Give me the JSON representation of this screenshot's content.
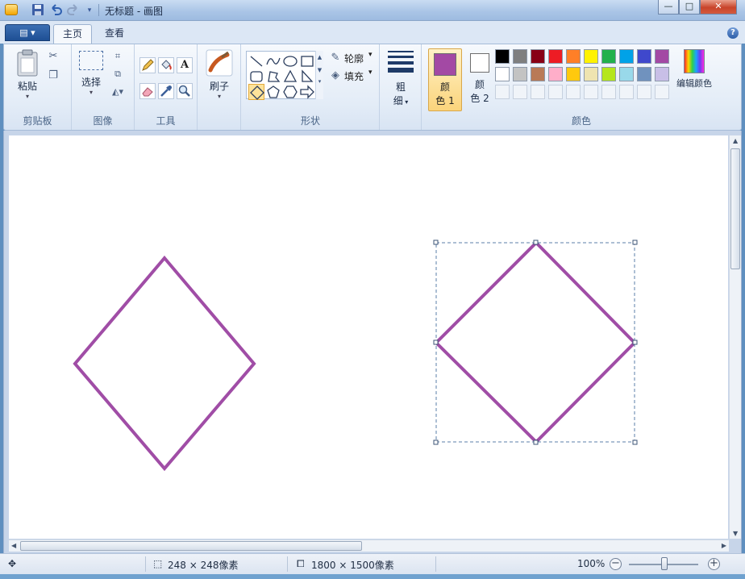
{
  "window": {
    "title": "无标题 - 画图",
    "buttons": {
      "minimize": "—",
      "maximize": "□",
      "close": "✕"
    }
  },
  "quick_access": {
    "save_icon": "save-icon",
    "undo_icon": "undo-icon",
    "redo_icon": "redo-icon",
    "customize_icon": "dropdown-icon"
  },
  "tabs": {
    "app_menu": "▤ ▾",
    "home": "主页",
    "view": "查看",
    "help": "?"
  },
  "ribbon": {
    "clipboard": {
      "paste": "粘贴",
      "group": "剪贴板"
    },
    "image": {
      "select": "选择",
      "group": "图像"
    },
    "tools": {
      "group": "工具",
      "text_tool": "A"
    },
    "brushes": {
      "label": "刷子"
    },
    "shapes": {
      "outline": "轮廓",
      "fill": "填充",
      "group": "形状"
    },
    "size": {
      "label_line1": "粗",
      "label_line2": "细"
    },
    "colors": {
      "color1_line1": "颜",
      "color1_line2": "色 1",
      "color2_line1": "颜",
      "color2_line2": "色 2",
      "edit_colors": "编辑颜色",
      "group": "颜色",
      "color1_value": "#a349a4",
      "color2_value": "#ffffff",
      "palette_row1": [
        "#000000",
        "#7f7f7f",
        "#880015",
        "#ed1c24",
        "#ff7f27",
        "#fff200",
        "#22b14c",
        "#00a2e8",
        "#3f48cc",
        "#a349a4"
      ],
      "palette_row2": [
        "#ffffff",
        "#c3c3c3",
        "#b97a57",
        "#ffaec9",
        "#ffc90e",
        "#efe4b0",
        "#b5e61d",
        "#99d9ea",
        "#7092be",
        "#c8bfe7"
      ]
    }
  },
  "canvas": {
    "stroke_color": "#a04da6",
    "handle_color": "#5b7fa9"
  },
  "status": {
    "selection_size": "248 × 248像素",
    "image_size": "1800 × 1500像素",
    "zoom": "100%"
  }
}
